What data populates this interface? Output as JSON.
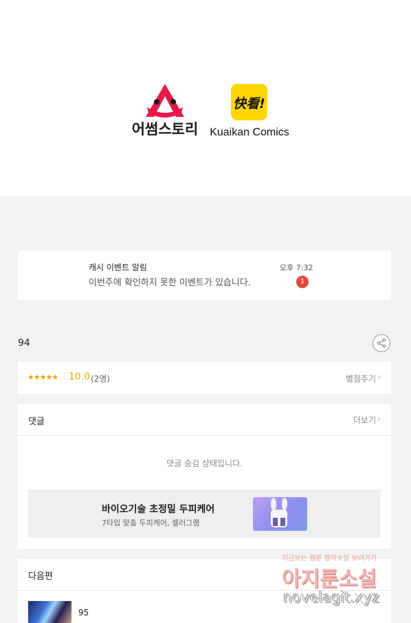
{
  "banner": {
    "awesome_story_name": "어썸스토리",
    "kuaikan_logo_mark": "快看!",
    "kuaikan_name": "Kuaikan Comics"
  },
  "notification": {
    "title": "캐시 이벤트 알림",
    "message": "이번주에 확인하지 못한 이벤트가 있습니다.",
    "time": "오후 7:32",
    "badge_count": "1"
  },
  "episode": {
    "number": "94",
    "share_icon": "share-icon"
  },
  "rating": {
    "stars": "★★★★★",
    "score": "10.0",
    "count": "(2명)",
    "give_stars_label": "별점주기",
    "chevron": "›",
    "star_color": "#f5a300"
  },
  "comments": {
    "title": "댓글",
    "more_label": "더보기",
    "chevron": "›",
    "hidden_message": "댓글 숨김 상태입니다."
  },
  "ad": {
    "title": "바이오기술 초정밀 두피케어",
    "subtitle": "7타입 맞춤 두피케어, 셀러그램"
  },
  "next_episode": {
    "section_title": "다음편",
    "episode_number": "95"
  },
  "watermark": {
    "top_text": "지금보는 웹툰 웹작소설 보러가기",
    "main_text": "아지툰소설",
    "url": "novelagit.xyz"
  },
  "colors": {
    "notification_badge": "#e4483a",
    "brand_red": "#e8174a",
    "kuaikan_yellow": "#ffd600"
  }
}
